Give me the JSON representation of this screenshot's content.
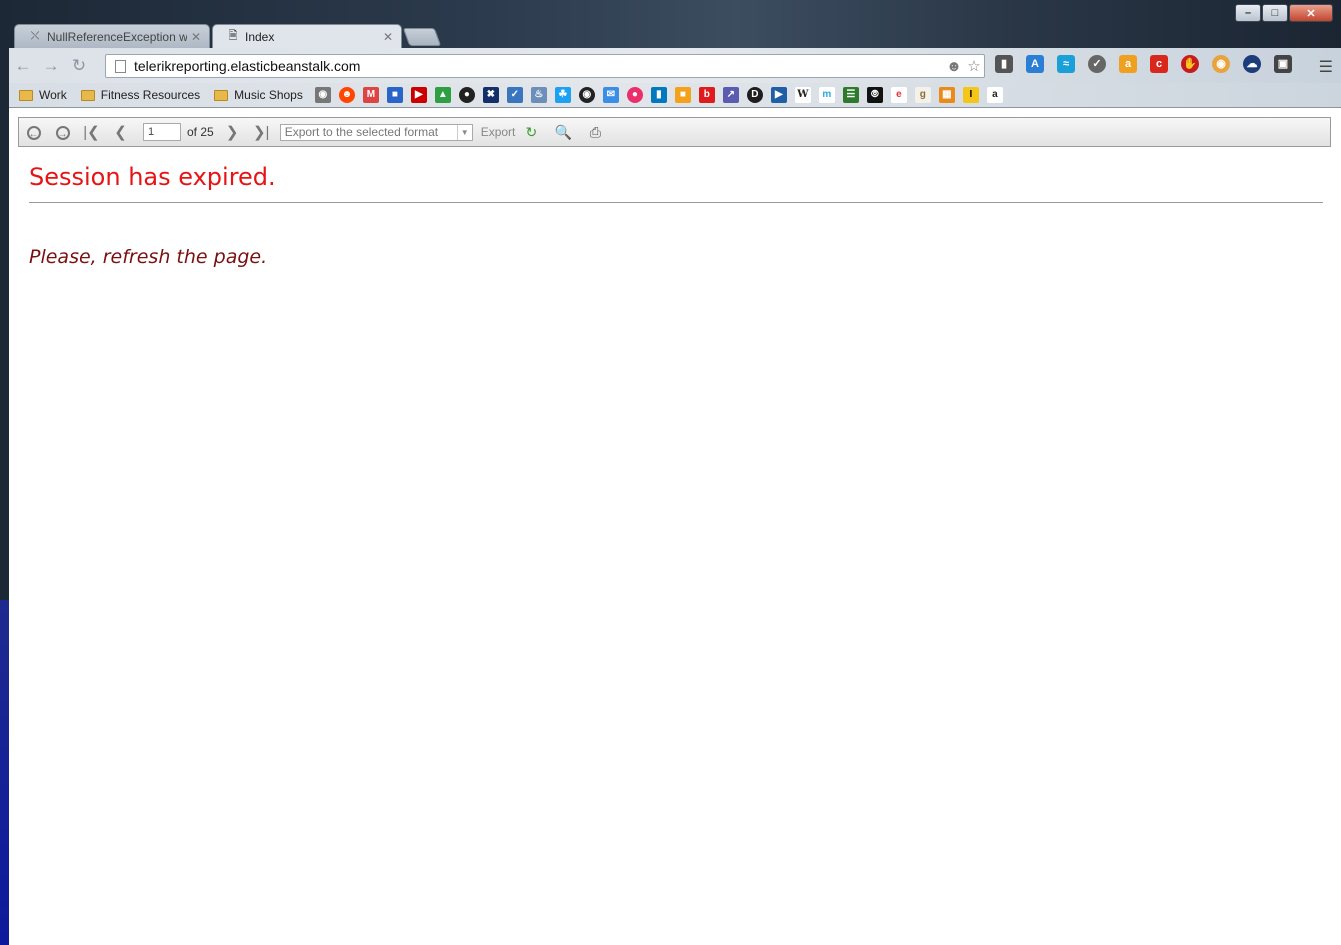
{
  "browser": {
    "tabs": [
      {
        "title": "NullReferenceException wh",
        "active": false
      },
      {
        "title": "Index",
        "active": true
      }
    ],
    "url": "telerikreporting.elasticbeanstalk.com",
    "bookmark_folders": [
      "Work",
      "Fitness Resources",
      "Music Shops"
    ]
  },
  "report_viewer": {
    "current_page": "1",
    "page_total_label": "of 25",
    "export_format_placeholder": "Export to the selected format",
    "export_label": "Export"
  },
  "message": {
    "title": "Session has expired.",
    "body": "Please, refresh the page."
  },
  "colors": {
    "error_title": "#e81313",
    "error_body": "#7a1010"
  }
}
